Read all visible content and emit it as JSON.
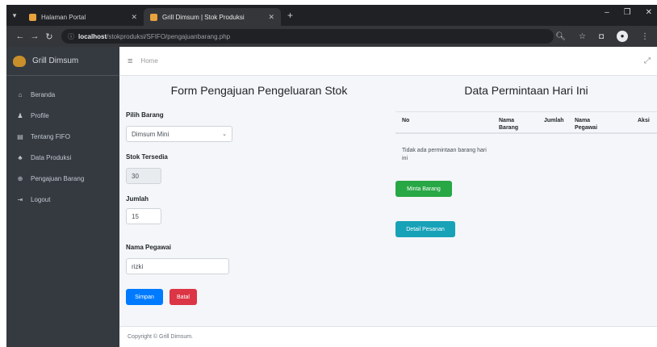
{
  "browser": {
    "tabs": [
      {
        "title": "Halaman Portal",
        "active": false
      },
      {
        "title": "Grill Dimsum | Stok Produksi",
        "active": true
      }
    ],
    "url_host": "localhost",
    "url_path": "/stokproduksi/SFIFO/pengajuanbarang.php",
    "icons": {
      "back": "arrow-left-icon",
      "forward": "arrow-right-icon",
      "reload": "reload-icon",
      "bookmark": "star-icon",
      "extensions": "puzzle-icon",
      "menu": "kebab-icon"
    }
  },
  "sidebar": {
    "brand": "Grill Dimsum",
    "items": [
      {
        "label": "Beranda",
        "icon": "home-icon"
      },
      {
        "label": "Profile",
        "icon": "user-icon"
      },
      {
        "label": "Tentang FIFO",
        "icon": "book-icon"
      },
      {
        "label": "Data Produksi",
        "icon": "users-icon"
      },
      {
        "label": "Pengajuan Barang",
        "icon": "circle-plus-icon"
      },
      {
        "label": "Logout",
        "icon": "logout-icon"
      }
    ]
  },
  "topnav": {
    "home_link": "Home"
  },
  "form": {
    "title": "Form Pengajuan Pengeluaran Stok",
    "barang_label": "Pilih Barang",
    "barang_value": "Dimsum Mini",
    "stok_label": "Stok Tersedia",
    "stok_value": "30",
    "jumlah_label": "Jumlah",
    "jumlah_value": "15",
    "pegawai_label": "Nama Pegawai",
    "pegawai_value": "rizki",
    "submit_label": "Simpan",
    "cancel_label": "Batal"
  },
  "requests": {
    "title": "Data Permintaan Hari Ini",
    "columns": [
      "No",
      "Nama Barang",
      "Jumlah",
      "Nama Pegawai",
      "Aksi"
    ],
    "empty_text": "Tidak ada permintaan barang hari ini",
    "request_button": "Minta Barang",
    "detail_button": "Detail Pesanan"
  },
  "footer": {
    "copyright": "Copyright © Grill Dimsum."
  },
  "colors": {
    "sidebar": "#343a40",
    "primary": "#007bff",
    "danger": "#dc3545",
    "success": "#28a745",
    "info": "#17a2b8"
  }
}
